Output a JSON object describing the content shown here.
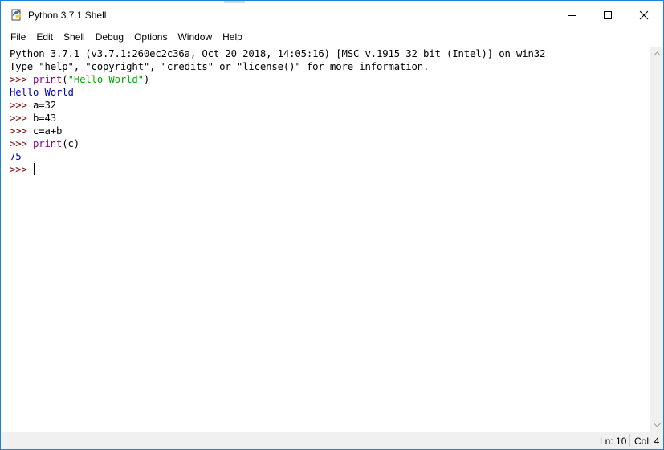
{
  "window": {
    "title": "Python 3.7.1 Shell",
    "icon": "python-idle-icon"
  },
  "menu": {
    "items": [
      "File",
      "Edit",
      "Shell",
      "Debug",
      "Options",
      "Window",
      "Help"
    ]
  },
  "shell": {
    "banner_line1": "Python 3.7.1 (v3.7.1:260ec2c36a, Oct 20 2018, 14:05:16) [MSC v.1915 32 bit (Intel)] on win32",
    "banner_line2": "Type \"help\", \"copyright\", \"credits\" or \"license()\" for more information.",
    "prompt": ">>> ",
    "line3_kw": "print",
    "line3_open": "(",
    "line3_str": "\"Hello World\"",
    "line3_close": ")",
    "line4_output": "Hello World",
    "line5_code": "a=32",
    "line6_code": "b=43",
    "line7_code": "c=a+b",
    "line8_kw": "print",
    "line8_rest": "(c)",
    "line9_output": "75"
  },
  "status": {
    "line": "Ln: 10",
    "col": "Col: 4"
  },
  "colors": {
    "prompt": "#770000",
    "keyword": "#900090",
    "string": "#00aa00",
    "output": "#0000bb",
    "window_border": "#1883d7"
  }
}
